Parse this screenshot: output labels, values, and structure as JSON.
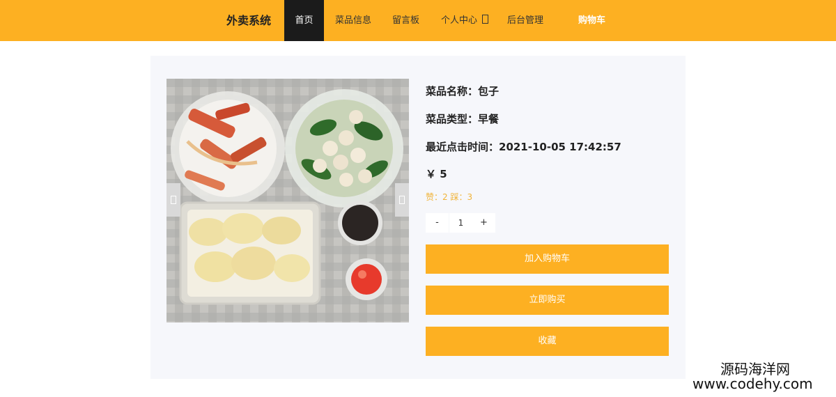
{
  "nav": {
    "brand": "外卖系统",
    "items": [
      {
        "label": "首页"
      },
      {
        "label": "菜品信息"
      },
      {
        "label": "留言板"
      },
      {
        "label": "个人中心"
      },
      {
        "label": "后台管理"
      }
    ],
    "cart": "购物车"
  },
  "product": {
    "name_line": "菜品名称：包子",
    "type_line": "菜品类型：早餐",
    "clicktime_line": "最近点击时间：2021-10-05 17:42:57",
    "price": "￥ 5",
    "votes": "赞：2 踩：3",
    "qty_minus": "-",
    "qty_value": "1",
    "qty_plus": "+",
    "add_to_cart": "加入购物车",
    "buy_now": "立即购买",
    "favorite": "收藏"
  },
  "watermark": {
    "line1": "源码海洋网",
    "line2": "www.codehy.com"
  },
  "colors": {
    "accent": "#fdb022",
    "nav_active_bg": "#1b1b1b",
    "card_bg": "#f6f7fb",
    "votes_text": "#f0b43a"
  }
}
